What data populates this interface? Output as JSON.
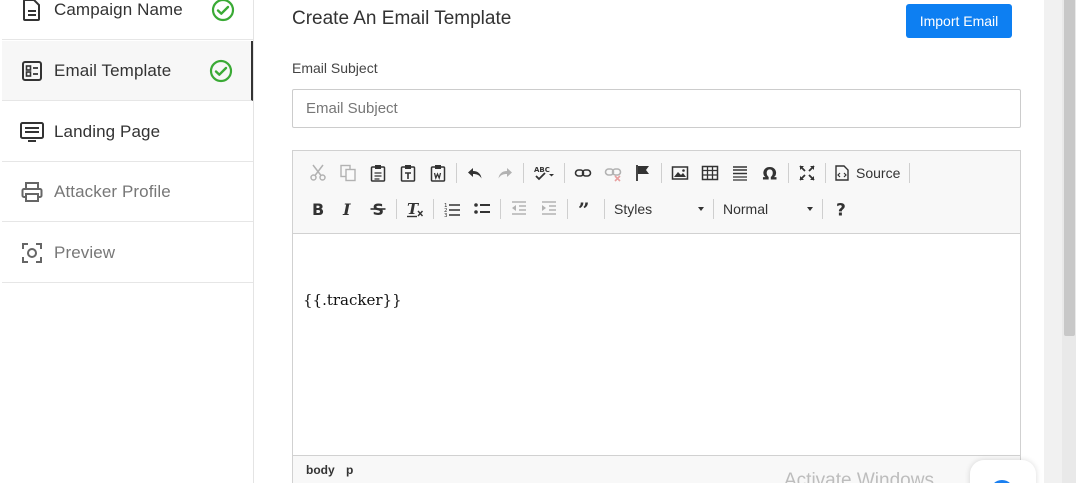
{
  "sidebar": {
    "items": [
      {
        "label": "Campaign Name",
        "icon": "document-icon",
        "completed": true
      },
      {
        "label": "Email Template",
        "icon": "template-icon",
        "completed": true,
        "active": true
      },
      {
        "label": "Landing Page",
        "icon": "monitor-icon",
        "completed": false
      },
      {
        "label": "Attacker Profile",
        "icon": "printer-icon",
        "completed": false
      },
      {
        "label": "Preview",
        "icon": "scan-icon",
        "completed": false
      }
    ],
    "check_color": "#3aaa35"
  },
  "main": {
    "title": "Create An Email Template",
    "import_button": "Import Email",
    "subject_label": "Email Subject",
    "subject_placeholder": "Email Subject",
    "subject_value": ""
  },
  "editor": {
    "source_label": "Source",
    "styles_label": "Styles",
    "format_label": "Normal",
    "content": "{{.tracker}}",
    "path": [
      "body",
      "p"
    ]
  },
  "overlay": {
    "watermark": "Activate Windows"
  },
  "colors": {
    "accent": "#0d7ff2"
  }
}
